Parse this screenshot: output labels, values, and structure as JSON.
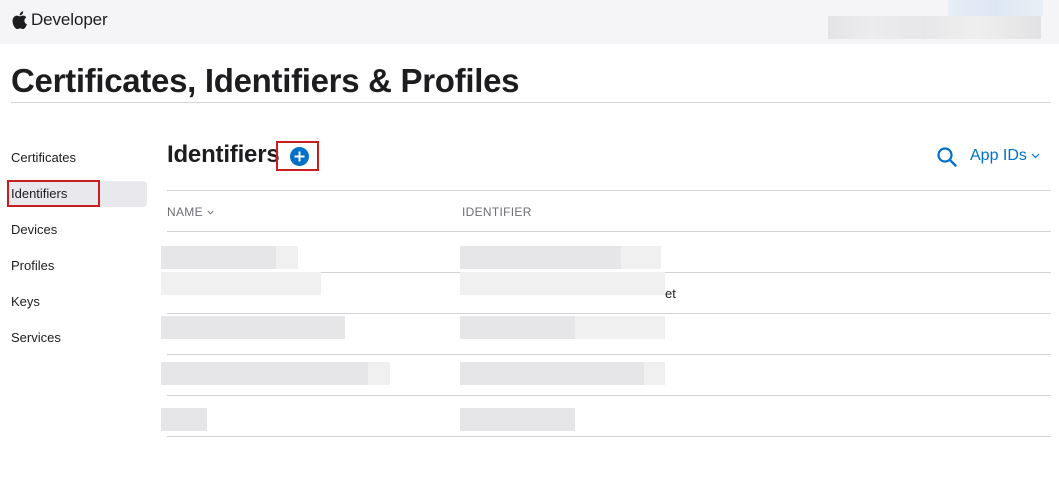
{
  "header": {
    "brand_text": "Developer",
    "brand_icon": "apple-logo-icon"
  },
  "page": {
    "title": "Certificates, Identifiers & Profiles"
  },
  "sidebar": {
    "items": [
      {
        "label": "Certificates"
      },
      {
        "label": "Identifiers",
        "active": true
      },
      {
        "label": "Devices"
      },
      {
        "label": "Profiles"
      },
      {
        "label": "Keys"
      },
      {
        "label": "Services"
      }
    ]
  },
  "main": {
    "section_title": "Identifiers",
    "add_icon": "plus-circle-icon",
    "search_icon": "search-icon",
    "filter_label": "App IDs",
    "filter_icon": "chevron-down-icon"
  },
  "table": {
    "columns": [
      "NAME",
      "IDENTIFIER"
    ],
    "rows": [
      {
        "name": "",
        "identifier": ""
      },
      {
        "name": "",
        "identifier": "et"
      },
      {
        "name": "",
        "identifier": ""
      },
      {
        "name": "",
        "identifier": ""
      },
      {
        "name": "",
        "identifier": ""
      }
    ]
  },
  "colors": {
    "accent": "#0070c9",
    "highlight": "#c81e1e",
    "topbar_bg": "#f5f5f7"
  }
}
